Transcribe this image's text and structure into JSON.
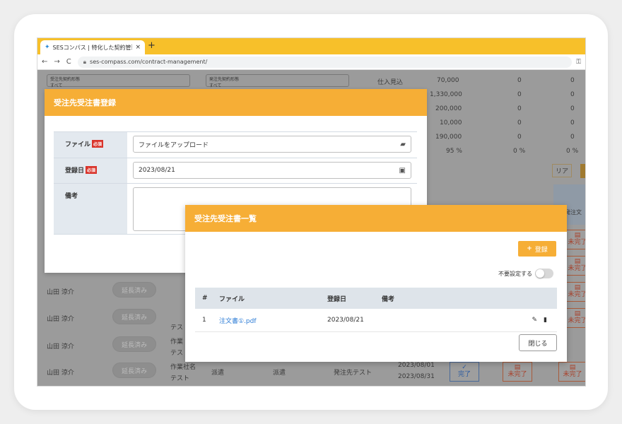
{
  "browser": {
    "tab_title": "SESコンパス | 特化した契約管理・営",
    "tab_close": "×",
    "new_tab": "+",
    "nav_back": "←",
    "nav_forward": "→",
    "nav_reload": "C",
    "url": "ses-compass.com/contract-management/"
  },
  "background": {
    "filter1_label": "受注先契約形態",
    "filter1_value": "すべて",
    "filter2_label": "発注先契約形態",
    "filter2_value": "すべて",
    "summary_label": "仕入見込",
    "col1": [
      "70,000",
      "1,330,000",
      "200,000",
      "10,000",
      "190,000",
      "95 %"
    ],
    "col2": [
      "0",
      "0",
      "0",
      "0",
      "0",
      "0 %"
    ],
    "col3": [
      "0",
      "0",
      "0",
      "0",
      "0",
      "0 %"
    ],
    "clear_btn": "リア",
    "col_head": "発注文",
    "rows": [
      {
        "name": "山田 涼介",
        "badge": "延長済み",
        "status": "未完了"
      },
      {
        "name": "山田 涼介",
        "badge": "延長済み",
        "status": "未完了"
      },
      {
        "name": "山田 涼介",
        "badge": "延長済み",
        "status": "未完了"
      },
      {
        "name": "山田 涼介",
        "badge": "延長済み",
        "status": "未完了"
      }
    ],
    "last_row": {
      "company": "作業社名",
      "company2": "テスト",
      "type1": "派遣",
      "type2": "派遣",
      "client": "発注先テスト",
      "start": "2023/08/01",
      "end": "2023/08/31",
      "done": "完了",
      "pending": "未完了"
    },
    "partial_texts": [
      "テス",
      "作業",
      "テスト"
    ]
  },
  "modal_register": {
    "title": "受注先受注書登録",
    "file_label": "ファイル",
    "required": "必須",
    "file_placeholder": "ファイルをアップロード",
    "date_label": "登録日",
    "date_value": "2023/08/21",
    "note_label": "備考"
  },
  "modal_list": {
    "title": "受注先受注書一覧",
    "register_btn": "登録",
    "toggle_label": "不要設定する",
    "headers": {
      "num": "#",
      "file": "ファイル",
      "date": "登録日",
      "note": "備考"
    },
    "rows": [
      {
        "num": "1",
        "file": "注文書①.pdf",
        "date": "2023/08/21",
        "note": ""
      }
    ],
    "close_btn": "閉じる"
  }
}
